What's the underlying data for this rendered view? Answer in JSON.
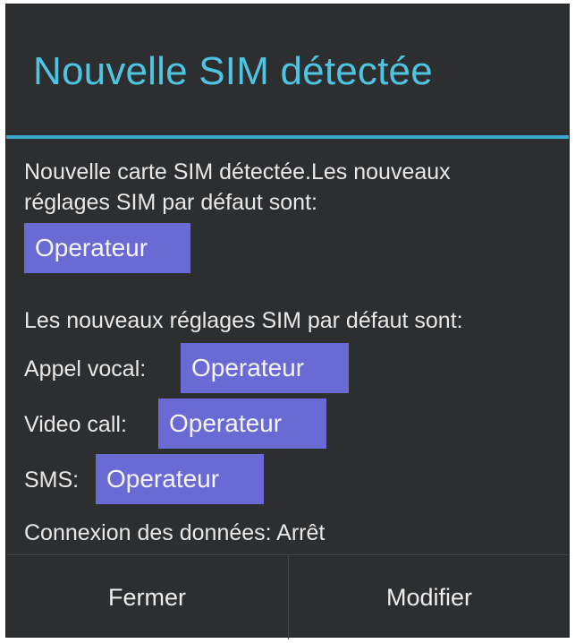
{
  "dialog": {
    "title": "Nouvelle SIM détectée",
    "message_line1": "Nouvelle carte SIM détectée.Les nouveaux",
    "message_line2": "réglages SIM par défaut sont:",
    "default_sim_chip": "Operateur",
    "new_defaults_label": "Les nouveaux réglages SIM par défaut sont:",
    "rows": [
      {
        "label": "Appel vocal:",
        "value": "Operateur"
      },
      {
        "label": "Video call:",
        "value": "Operateur"
      },
      {
        "label": "SMS:",
        "value": "Operateur"
      }
    ],
    "data_connection": "Connexion des données: Arrêt",
    "buttons": {
      "close": "Fermer",
      "modify": "Modifier"
    }
  },
  "colors": {
    "background": "#2d2e30",
    "title": "#4fc4e0",
    "divider": "#3aa9cc",
    "chip": "#6a6ad4",
    "text": "#e8e8e8"
  }
}
